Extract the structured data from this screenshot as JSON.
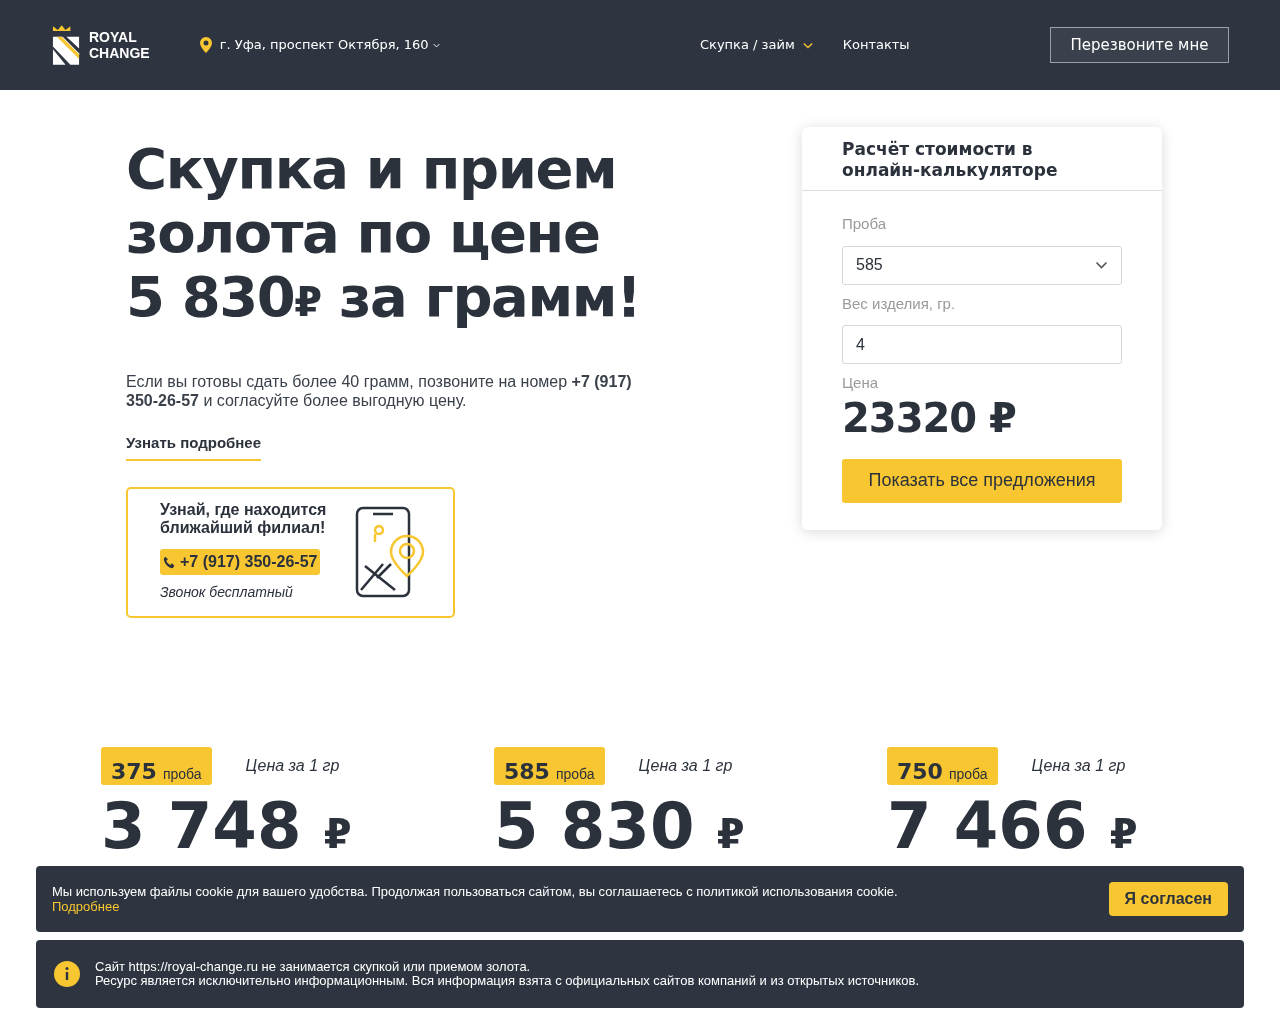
{
  "header": {
    "logo_top": "ROYAL",
    "logo_bottom": "CHANGE",
    "address": "г. Уфа, проспект Октября, 160",
    "nav": [
      {
        "label": "Скупка / займ",
        "has_menu": true
      },
      {
        "label": "Контакты",
        "has_menu": false
      }
    ],
    "callback_button": "Перезвоните мне"
  },
  "hero": {
    "title_lines": [
      "Скупка и прием",
      "золота по цене"
    ],
    "title_price": "5 830",
    "title_currency": "₽",
    "title_end": "за грамм!",
    "text": "Если вы готовы сдать более 40 грамм, позвоните на номер **+7 (917) 350-26-57** и согласуйте более выгодную цену.",
    "more_link": "Узнать подробнее",
    "branch_card": {
      "title": "Узнай, где находится ближайший филиал!",
      "phone": "+7 (917) 350-26-57",
      "note": "Звонок бесплатный"
    }
  },
  "calculator": {
    "title": "Расчёт стоимости в онлайн-калькуляторе",
    "fields": [
      {
        "label": "Проба",
        "kind": "select",
        "value": "585"
      },
      {
        "label": "Вес изделия, гр.",
        "kind": "input",
        "value": "4"
      }
    ],
    "price_label": "Цена",
    "price": "23320",
    "currency": "₽",
    "button": "Показать все предложения"
  },
  "prices": [
    {
      "assay": "375",
      "assay_label": "проба",
      "caption": "Цена за 1 гр",
      "price": "3 748",
      "currency": "₽"
    },
    {
      "assay": "585",
      "assay_label": "проба",
      "caption": "Цена за 1 гр",
      "price": "5 830",
      "currency": "₽"
    },
    {
      "assay": "750",
      "assay_label": "проба",
      "caption": "Цена за 1 гр",
      "price": "7 466",
      "currency": "₽"
    }
  ],
  "cookie_banner": {
    "text": "Мы используем файлы cookie для вашего удобства. Продолжая пользоваться сайтом, вы соглашаетесь с политикой использования cookie.",
    "link": "Подробнее",
    "button": "Я согласен"
  },
  "info_banner": {
    "lines": [
      "Сайт https://royal-change.ru не занимается скупкой или приемом золота.",
      "Ресурс является исключительно информационным. Вся информация взята с официальных сайтов компаний и из открытых источников."
    ]
  }
}
